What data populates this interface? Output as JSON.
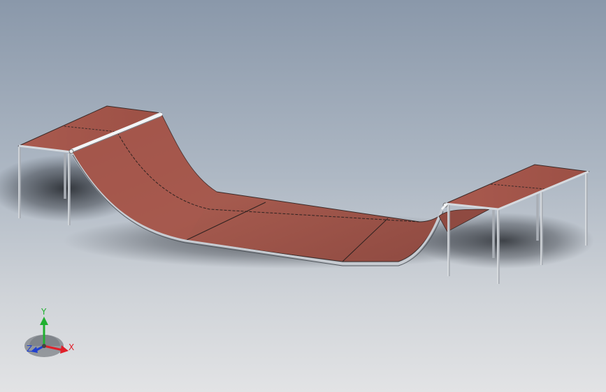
{
  "viewport": {
    "background_top": "#8a98aa",
    "background_bottom": "#e2e3e5"
  },
  "model": {
    "ramp_color": "#a4564b",
    "ramp_edge_color": "#3a2a28",
    "frame_color": "#c8ccd2",
    "coping_color": "#f2f4f6"
  },
  "triad": {
    "x_label": "X",
    "y_label": "Y",
    "z_label": "Z",
    "x_color": "#e0202a",
    "y_color": "#20b030",
    "z_color": "#2040d0"
  }
}
